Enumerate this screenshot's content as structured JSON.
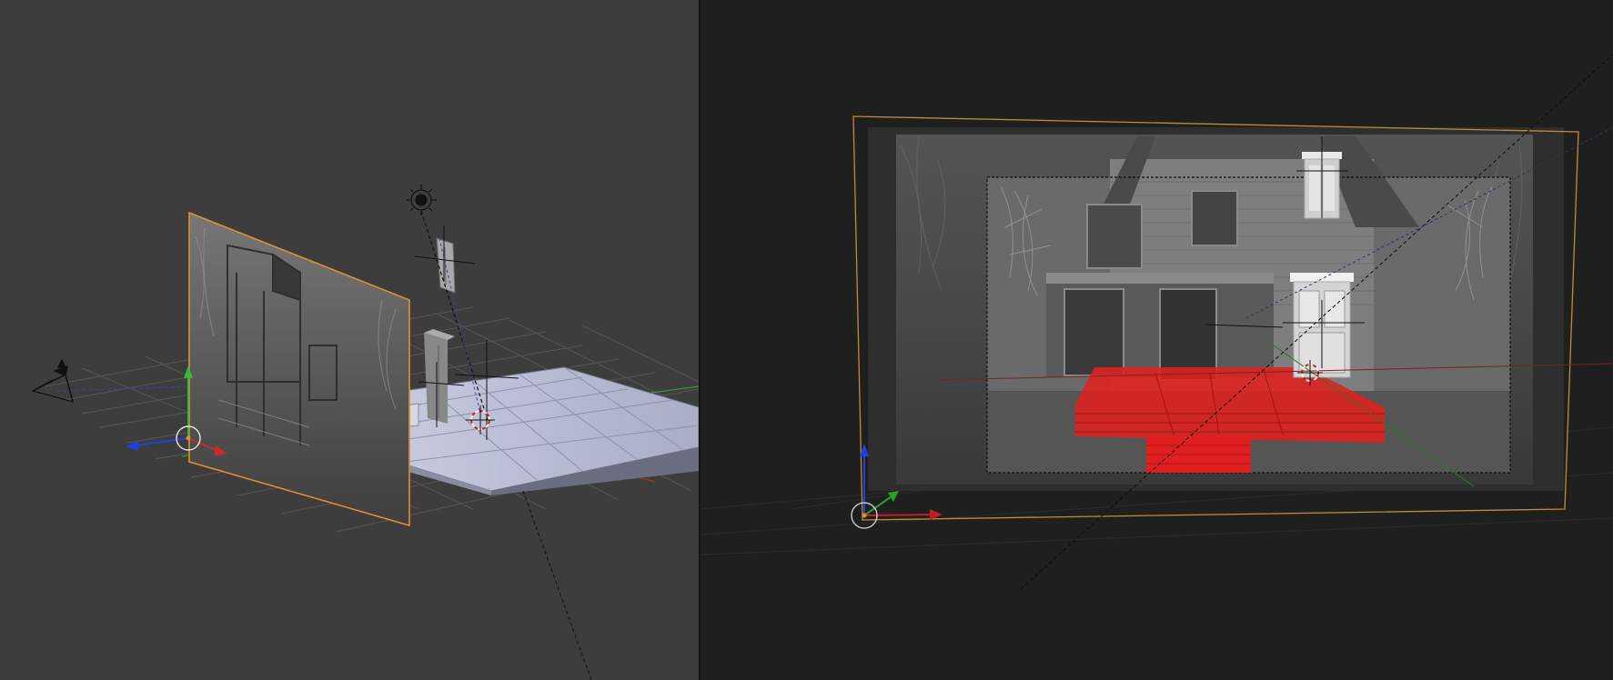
{
  "viewports": {
    "left": {
      "view": "user-perspective"
    },
    "right": {
      "view": "camera-view"
    }
  },
  "colors": {
    "left_background": "#3d3d3d",
    "right_background": "#1f1f1f",
    "grid": "#555555",
    "axis_x": "#d02828",
    "axis_y": "#38b838",
    "axis_z": "#2040e0",
    "selection_outline": "#e0902a",
    "highlighted_mesh": "#e02020",
    "floor_mesh": "#b4b8cc"
  },
  "icons": [
    "camera-icon",
    "lamp-icon",
    "empty-icon",
    "origin-icon",
    "transform-gizmo-icon",
    "3d-cursor-icon"
  ]
}
